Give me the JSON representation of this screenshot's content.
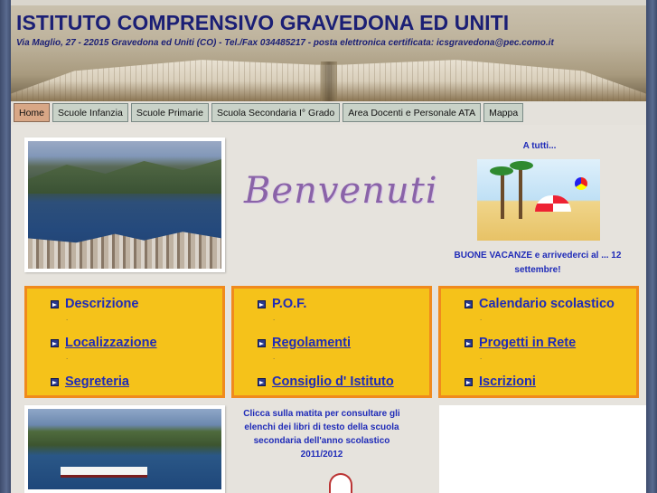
{
  "header": {
    "title": "ISTITUTO COMPRENSIVO GRAVEDONA ED UNITI",
    "subtitle": "Via Maglio, 27 - 22015 Gravedona ed Uniti (CO) - Tel./Fax 034485217 - posta elettronica certificata: icsgravedona@pec.como.it"
  },
  "nav": {
    "items": [
      {
        "label": "Home",
        "active": true
      },
      {
        "label": "Scuole Infanzia"
      },
      {
        "label": "Scuole Primarie"
      },
      {
        "label": "Scuola Secondaria I° Grado"
      },
      {
        "label": "Area Docenti e Personale ATA"
      },
      {
        "label": "Mappa"
      }
    ]
  },
  "welcome": {
    "text": "Benvenuti"
  },
  "greeting": {
    "title": "A tutti...",
    "message": "BUONE VACANZE e arrivederci al ... 12 settembre!"
  },
  "boxes": [
    {
      "links": [
        {
          "label": "Descrizione",
          "underline": false
        },
        {
          "label": "Localizzazione",
          "underline": true
        },
        {
          "label": "Segreteria",
          "underline": true
        }
      ]
    },
    {
      "links": [
        {
          "label": "P.O.F.",
          "underline": false
        },
        {
          "label": "Regolamenti",
          "underline": true
        },
        {
          "label": "Consiglio d' Istituto",
          "underline": true
        }
      ]
    },
    {
      "links": [
        {
          "label": "Calendario scolastico",
          "underline": false
        },
        {
          "label": "Progetti in Rete",
          "underline": true
        },
        {
          "label": "Iscrizioni",
          "underline": true
        }
      ]
    }
  ],
  "separator": ".",
  "notice": {
    "text": "Clicca sulla matita per consultare gli elenchi dei libri di testo della scuola secondaria dell'anno scolastico 2011/2012"
  },
  "colors": {
    "title": "#1b1f75",
    "link": "#1f2bb8",
    "box_bg": "#f5c21a",
    "box_border": "#f08a1d",
    "welcome": "#8a63a8"
  }
}
